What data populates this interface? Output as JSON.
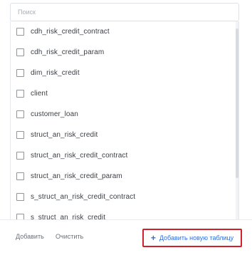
{
  "search": {
    "placeholder": "Поиск"
  },
  "tables": [
    {
      "label": "cdh_risk_credit_contract"
    },
    {
      "label": "cdh_risk_credit_param"
    },
    {
      "label": "dim_risk_credit"
    },
    {
      "label": "client"
    },
    {
      "label": "customer_loan"
    },
    {
      "label": "struct_an_risk_credit"
    },
    {
      "label": "struct_an_risk_credit_contract"
    },
    {
      "label": "struct_an_risk_credit_param"
    },
    {
      "label": "s_struct_an_risk_credit_contract"
    },
    {
      "label": "s_struct_an_risk_credit"
    }
  ],
  "footer": {
    "select_all_label": "Добавить",
    "reset_label": "Очистить",
    "add_table_label": "Добавить новую таблицу",
    "add_icon": "+"
  },
  "colors": {
    "accent": "#2f6fdc",
    "highlight_border": "#d0212b"
  }
}
